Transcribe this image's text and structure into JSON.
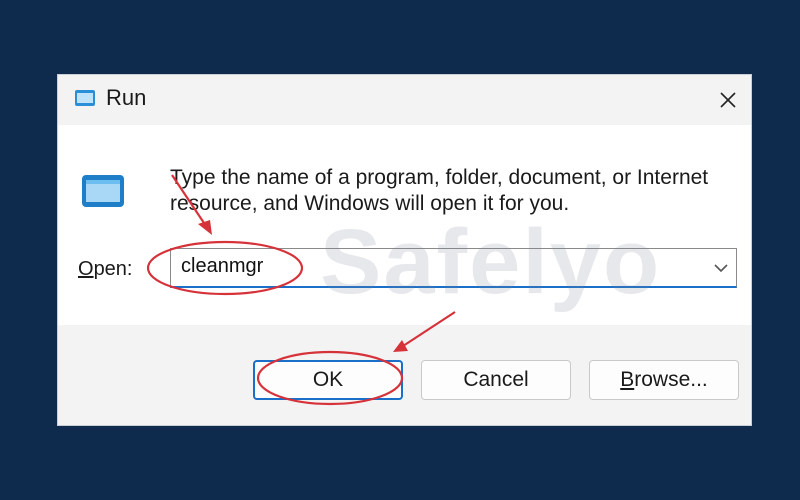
{
  "window": {
    "title": "Run",
    "icon": "run-icon",
    "close_icon": "close-icon"
  },
  "body": {
    "description": "Type the name of a program, folder, document, or Internet resource, and Windows will open it for you.",
    "open_label_underlined": "O",
    "open_label_rest": "pen:",
    "open_value": "cleanmgr",
    "dropdown_icon": "chevron-down-icon"
  },
  "buttons": {
    "ok": "OK",
    "cancel": "Cancel",
    "browse_underlined": "B",
    "browse_rest": "rowse..."
  },
  "watermark": "Safelyo",
  "colors": {
    "page_background": "#0e2a4d",
    "accent_blue": "#1a6fc9",
    "annotation_red": "#d6323a"
  }
}
